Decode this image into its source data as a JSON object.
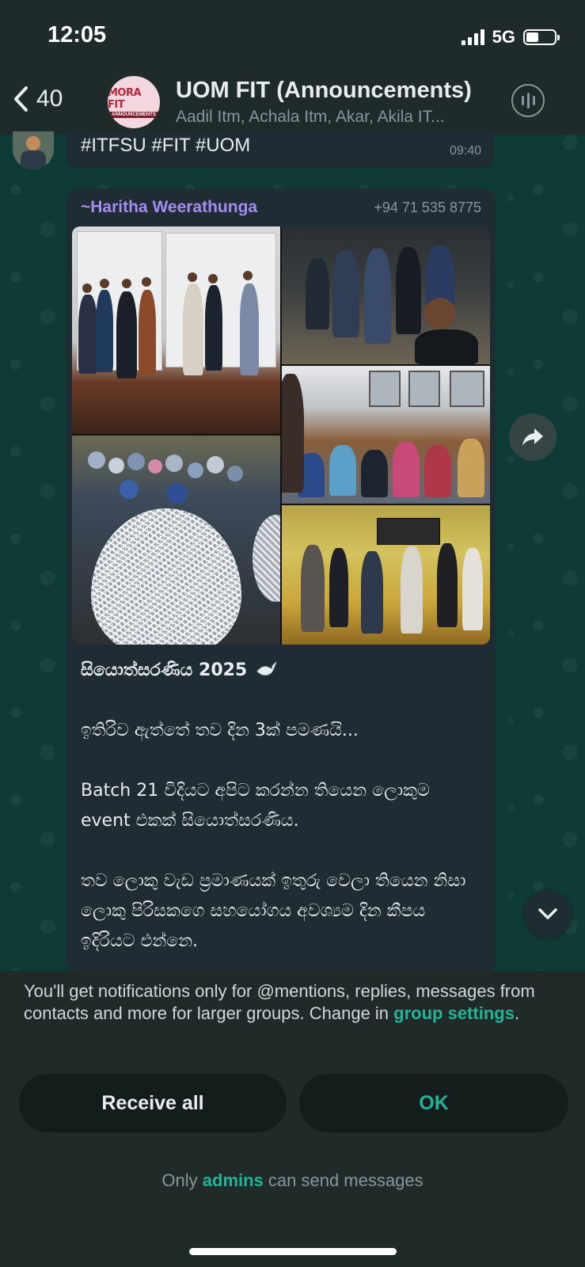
{
  "status_bar": {
    "time": "12:05",
    "network": "5G"
  },
  "header": {
    "back_count": "40",
    "avatar_top": "MORA FIT",
    "avatar_bottom": "ANNOUNCEMENTS",
    "title": "UOM FIT (Announcements)",
    "members": "Aadil Itm, Achala Itm, Akar, Akila IT..."
  },
  "previous_message": {
    "text": "#ITFSU #FIT #UOM",
    "time": "09:40"
  },
  "message": {
    "sender_name": "~Haritha Weerathunga",
    "sender_phone": "+94 71 535 8775",
    "photos": [
      "stage-presentation",
      "group-selfie-night",
      "decorations-egg",
      "classroom-group",
      "dance-practice"
    ],
    "paragraphs": [
      "සියොත්සරණිය 2025",
      "ඉතිරිව ඇත්තේ තව දින 3ක් පමණයි...",
      "Batch 21 විදියට අපිට කරන්න තියෙන ලොකුම event එකක් සියොත්සරණිය.",
      "තව ලොකු වැඩ ප්‍රමාණයක් ඉතුරු වෙලා තියෙන නිසා ලොකු පිරිසකගෙ සහයෝගය අවශ්‍යම දින කීපය ඉදිරියට එන්නෙ."
    ]
  },
  "notice": {
    "text": "You'll get notifications only for @mentions, replies, messages from contacts and more for larger groups. Change in ",
    "link": "group settings",
    "end": "."
  },
  "buttons": {
    "receive_all": "Receive all",
    "ok": "OK"
  },
  "footer": {
    "prefix": "Only ",
    "admins": "admins",
    "suffix": " can send messages"
  },
  "colors": {
    "accent": "#25b398",
    "sender_name": "#a48cf2",
    "bubble": "#202c33"
  }
}
